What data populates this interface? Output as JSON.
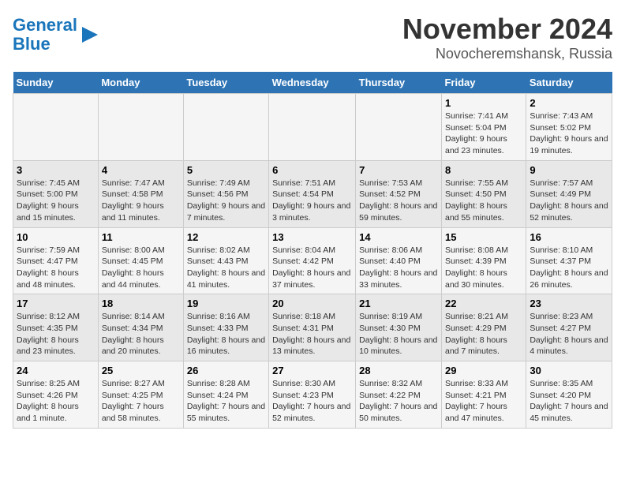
{
  "logo": {
    "line1": "General",
    "line2": "Blue"
  },
  "title": "November 2024",
  "subtitle": "Novocheremshansk, Russia",
  "days_of_week": [
    "Sunday",
    "Monday",
    "Tuesday",
    "Wednesday",
    "Thursday",
    "Friday",
    "Saturday"
  ],
  "weeks": [
    [
      {
        "day": "",
        "info": ""
      },
      {
        "day": "",
        "info": ""
      },
      {
        "day": "",
        "info": ""
      },
      {
        "day": "",
        "info": ""
      },
      {
        "day": "",
        "info": ""
      },
      {
        "day": "1",
        "info": "Sunrise: 7:41 AM\nSunset: 5:04 PM\nDaylight: 9 hours and 23 minutes."
      },
      {
        "day": "2",
        "info": "Sunrise: 7:43 AM\nSunset: 5:02 PM\nDaylight: 9 hours and 19 minutes."
      }
    ],
    [
      {
        "day": "3",
        "info": "Sunrise: 7:45 AM\nSunset: 5:00 PM\nDaylight: 9 hours and 15 minutes."
      },
      {
        "day": "4",
        "info": "Sunrise: 7:47 AM\nSunset: 4:58 PM\nDaylight: 9 hours and 11 minutes."
      },
      {
        "day": "5",
        "info": "Sunrise: 7:49 AM\nSunset: 4:56 PM\nDaylight: 9 hours and 7 minutes."
      },
      {
        "day": "6",
        "info": "Sunrise: 7:51 AM\nSunset: 4:54 PM\nDaylight: 9 hours and 3 minutes."
      },
      {
        "day": "7",
        "info": "Sunrise: 7:53 AM\nSunset: 4:52 PM\nDaylight: 8 hours and 59 minutes."
      },
      {
        "day": "8",
        "info": "Sunrise: 7:55 AM\nSunset: 4:50 PM\nDaylight: 8 hours and 55 minutes."
      },
      {
        "day": "9",
        "info": "Sunrise: 7:57 AM\nSunset: 4:49 PM\nDaylight: 8 hours and 52 minutes."
      }
    ],
    [
      {
        "day": "10",
        "info": "Sunrise: 7:59 AM\nSunset: 4:47 PM\nDaylight: 8 hours and 48 minutes."
      },
      {
        "day": "11",
        "info": "Sunrise: 8:00 AM\nSunset: 4:45 PM\nDaylight: 8 hours and 44 minutes."
      },
      {
        "day": "12",
        "info": "Sunrise: 8:02 AM\nSunset: 4:43 PM\nDaylight: 8 hours and 41 minutes."
      },
      {
        "day": "13",
        "info": "Sunrise: 8:04 AM\nSunset: 4:42 PM\nDaylight: 8 hours and 37 minutes."
      },
      {
        "day": "14",
        "info": "Sunrise: 8:06 AM\nSunset: 4:40 PM\nDaylight: 8 hours and 33 minutes."
      },
      {
        "day": "15",
        "info": "Sunrise: 8:08 AM\nSunset: 4:39 PM\nDaylight: 8 hours and 30 minutes."
      },
      {
        "day": "16",
        "info": "Sunrise: 8:10 AM\nSunset: 4:37 PM\nDaylight: 8 hours and 26 minutes."
      }
    ],
    [
      {
        "day": "17",
        "info": "Sunrise: 8:12 AM\nSunset: 4:35 PM\nDaylight: 8 hours and 23 minutes."
      },
      {
        "day": "18",
        "info": "Sunrise: 8:14 AM\nSunset: 4:34 PM\nDaylight: 8 hours and 20 minutes."
      },
      {
        "day": "19",
        "info": "Sunrise: 8:16 AM\nSunset: 4:33 PM\nDaylight: 8 hours and 16 minutes."
      },
      {
        "day": "20",
        "info": "Sunrise: 8:18 AM\nSunset: 4:31 PM\nDaylight: 8 hours and 13 minutes."
      },
      {
        "day": "21",
        "info": "Sunrise: 8:19 AM\nSunset: 4:30 PM\nDaylight: 8 hours and 10 minutes."
      },
      {
        "day": "22",
        "info": "Sunrise: 8:21 AM\nSunset: 4:29 PM\nDaylight: 8 hours and 7 minutes."
      },
      {
        "day": "23",
        "info": "Sunrise: 8:23 AM\nSunset: 4:27 PM\nDaylight: 8 hours and 4 minutes."
      }
    ],
    [
      {
        "day": "24",
        "info": "Sunrise: 8:25 AM\nSunset: 4:26 PM\nDaylight: 8 hours and 1 minute."
      },
      {
        "day": "25",
        "info": "Sunrise: 8:27 AM\nSunset: 4:25 PM\nDaylight: 7 hours and 58 minutes."
      },
      {
        "day": "26",
        "info": "Sunrise: 8:28 AM\nSunset: 4:24 PM\nDaylight: 7 hours and 55 minutes."
      },
      {
        "day": "27",
        "info": "Sunrise: 8:30 AM\nSunset: 4:23 PM\nDaylight: 7 hours and 52 minutes."
      },
      {
        "day": "28",
        "info": "Sunrise: 8:32 AM\nSunset: 4:22 PM\nDaylight: 7 hours and 50 minutes."
      },
      {
        "day": "29",
        "info": "Sunrise: 8:33 AM\nSunset: 4:21 PM\nDaylight: 7 hours and 47 minutes."
      },
      {
        "day": "30",
        "info": "Sunrise: 8:35 AM\nSunset: 4:20 PM\nDaylight: 7 hours and 45 minutes."
      }
    ]
  ]
}
